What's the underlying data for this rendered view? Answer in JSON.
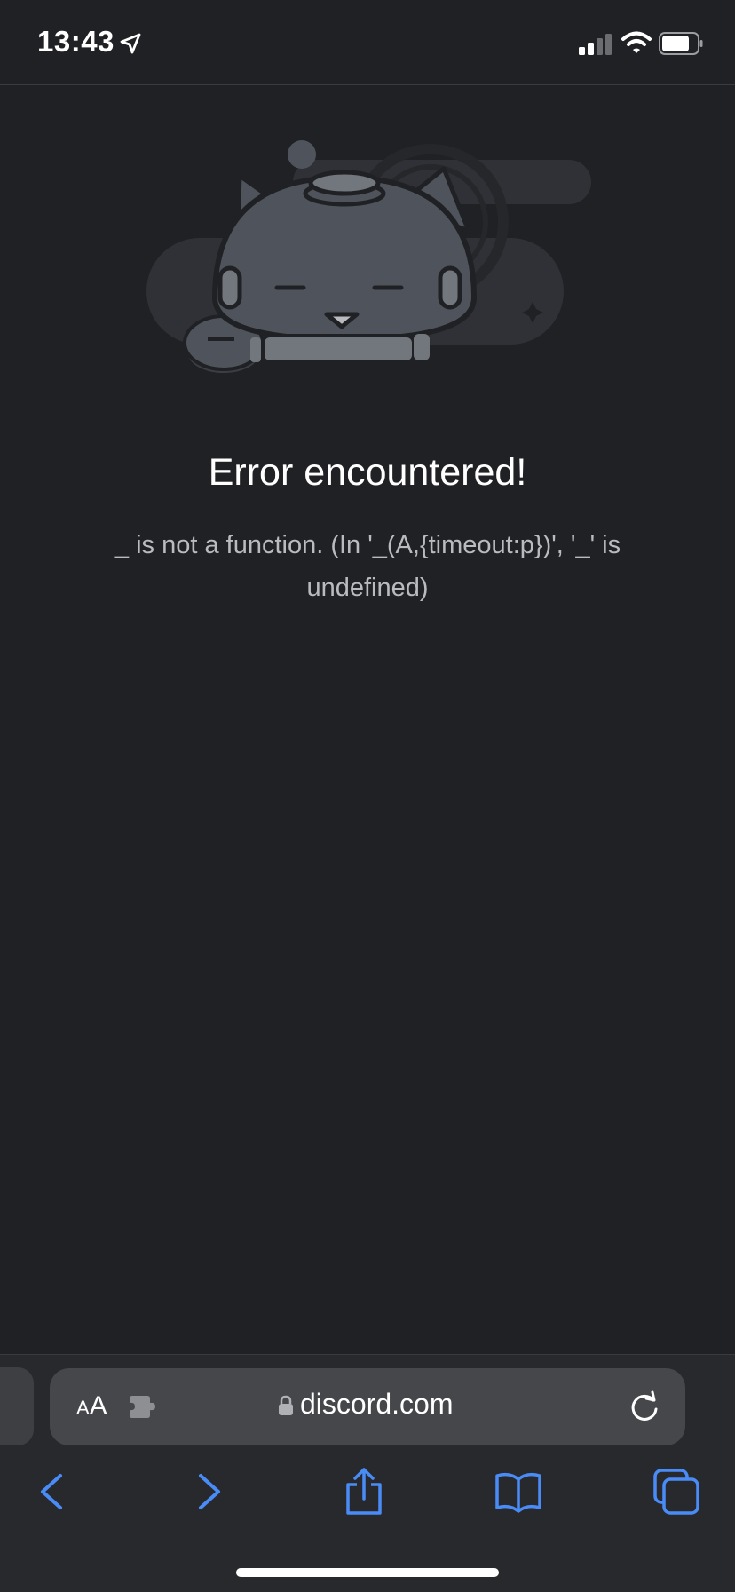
{
  "status_bar": {
    "time": "13:43",
    "icons": [
      "location-arrow-icon",
      "signal-icon",
      "wifi-icon",
      "battery-icon"
    ]
  },
  "error": {
    "title": "Error encountered!",
    "message": "_ is not a function. (In '_(A,{timeout:p})', '_' is undefined)"
  },
  "address_bar": {
    "text_size_small": "A",
    "text_size_large": "A",
    "url": "discord.com"
  },
  "toolbar_icons": [
    "back-icon",
    "forward-icon",
    "share-icon",
    "bookmarks-icon",
    "tabs-icon"
  ],
  "colors": {
    "background": "#202124",
    "toolbar": "#28292c",
    "accent": "#4a8cf7",
    "message_text": "#b9bbbe"
  }
}
